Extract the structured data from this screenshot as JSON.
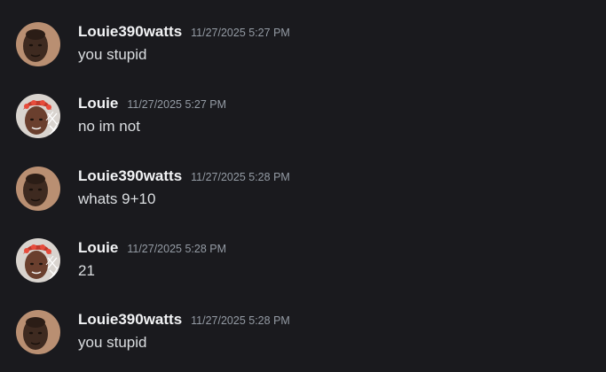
{
  "messages": [
    {
      "username": "Louie390watts",
      "timestamp": "11/27/2025 5:27 PM",
      "text": "you stupid",
      "avatar": "avatar-louie390watts"
    },
    {
      "username": "Louie",
      "timestamp": "11/27/2025 5:27 PM",
      "text": "no im not",
      "avatar": "avatar-louie"
    },
    {
      "username": "Louie390watts",
      "timestamp": "11/27/2025 5:28 PM",
      "text": "whats 9+10",
      "avatar": "avatar-louie390watts"
    },
    {
      "username": "Louie",
      "timestamp": "11/27/2025 5:28 PM",
      "text": "21",
      "avatar": "avatar-louie"
    },
    {
      "username": "Louie390watts",
      "timestamp": "11/27/2025 5:28 PM",
      "text": "you stupid",
      "avatar": "avatar-louie390watts"
    }
  ],
  "colors": {
    "background": "#1a1a1e",
    "username": "#f2f3f5",
    "timestamp": "#949ba4",
    "message_text": "#dbdee1"
  }
}
